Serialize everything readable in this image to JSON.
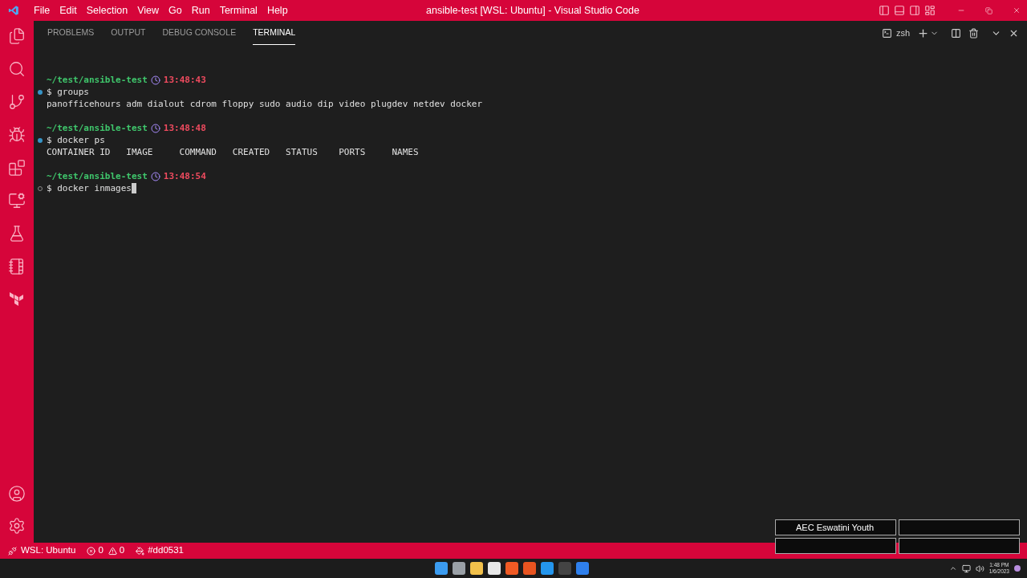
{
  "menu_bar": {
    "items": [
      "File",
      "Edit",
      "Selection",
      "View",
      "Go",
      "Run",
      "Terminal",
      "Help"
    ],
    "title": "ansible-test [WSL: Ubuntu] - Visual Studio Code"
  },
  "panel": {
    "tabs": [
      {
        "label": "PROBLEMS",
        "selected": false
      },
      {
        "label": "OUTPUT",
        "selected": false
      },
      {
        "label": "DEBUG CONSOLE",
        "selected": false
      },
      {
        "label": "TERMINAL",
        "selected": true
      }
    ],
    "shell": "zsh"
  },
  "terminal": {
    "blocks": [
      {
        "path": "~/test/ansible-test",
        "time": "13:48:43",
        "prompt": "$",
        "command": "groups",
        "finished": true,
        "cursor": false,
        "output": [
          "panofficehours adm dialout cdrom floppy sudo audio dip video plugdev netdev docker"
        ]
      },
      {
        "path": "~/test/ansible-test",
        "time": "13:48:48",
        "prompt": "$",
        "command": "docker ps",
        "finished": true,
        "cursor": false,
        "output": [
          "CONTAINER ID   IMAGE     COMMAND   CREATED   STATUS    PORTS     NAMES"
        ]
      },
      {
        "path": "~/test/ansible-test",
        "time": "13:48:54",
        "prompt": "$",
        "command": "docker inmages",
        "finished": false,
        "cursor": true
      }
    ]
  },
  "overlay": {
    "cells": [
      "AEC Eswatini Youth"
    ]
  },
  "status_bar": {
    "remote": "WSL: Ubuntu",
    "errors": "0",
    "warnings": "0",
    "color_label": "#dd0531"
  },
  "taskbar": {
    "time": "1:48 PM",
    "date": "1/6/2023"
  }
}
